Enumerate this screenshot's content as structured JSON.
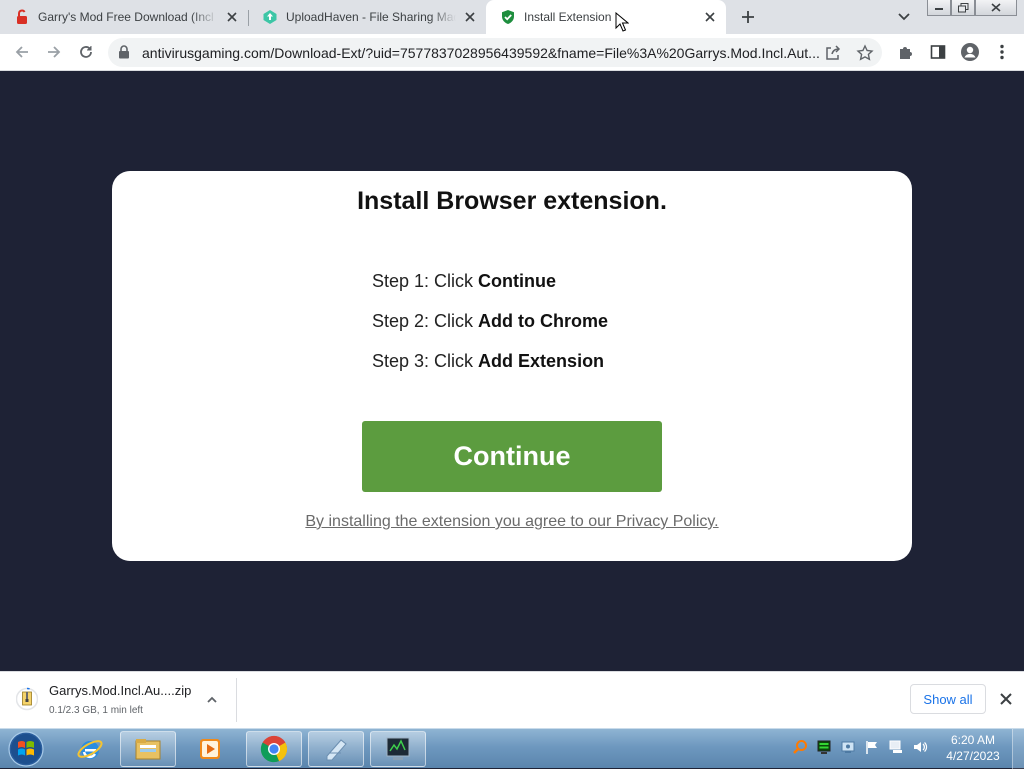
{
  "browser": {
    "tabs": [
      {
        "title": "Garry's Mod Free Download (Incl",
        "favicon": "lock-open-red-icon",
        "active": false
      },
      {
        "title": "UploadHaven - File Sharing Made",
        "favicon": "uploadhaven-icon",
        "active": false
      },
      {
        "title": "Install Extension",
        "favicon": "shield-check-green-icon",
        "active": true
      }
    ],
    "url": "antivirusgaming.com/Download-Ext/?uid=7577837028956439592&fname=File%3A%20Garrys.Mod.Incl.Aut..."
  },
  "page": {
    "title": "Install Browser extension.",
    "steps": [
      {
        "prefix": "Step 1: Click ",
        "action": "Continue"
      },
      {
        "prefix": "Step 2: Click ",
        "action": "Add to Chrome"
      },
      {
        "prefix": "Step 3: Click ",
        "action": "Add Extension"
      }
    ],
    "continue_label": "Continue",
    "policy_text": "By installing the extension you agree to our Privacy Policy.",
    "colors": {
      "background": "#1e2235",
      "card": "#ffffff",
      "button": "#5c9c3f"
    }
  },
  "downloads": {
    "filename": "Garrys.Mod.Incl.Au....zip",
    "status": "0.1/2.3 GB, 1 min left",
    "progress_fraction": 0.04,
    "show_all_label": "Show all"
  },
  "taskbar": {
    "apps": [
      "internet-explorer-icon",
      "file-explorer-icon",
      "media-player-icon",
      "chrome-icon",
      "notepad-icon",
      "task-manager-icon"
    ],
    "time": "6:20 AM",
    "date": "4/27/2023"
  }
}
